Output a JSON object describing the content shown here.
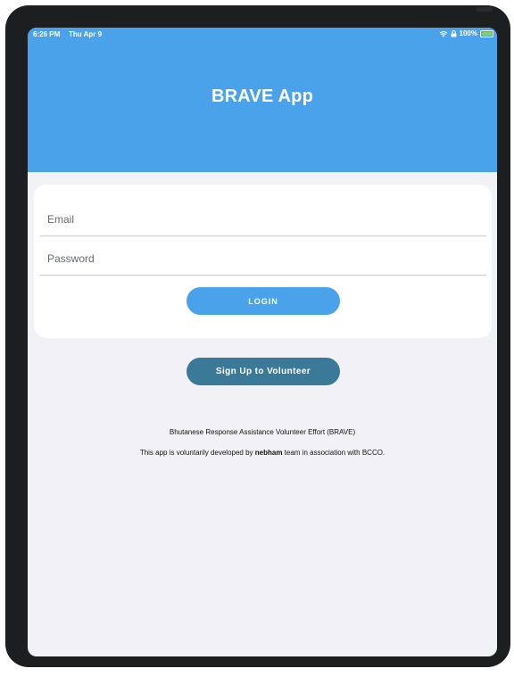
{
  "status_bar": {
    "time": "6:26 PM",
    "date": "Thu Apr 9",
    "battery": "100%",
    "icons": [
      "wifi-icon",
      "lock-rotation-icon",
      "battery-icon"
    ]
  },
  "header": {
    "title": "BRAVE App",
    "bg_color": "#4aa2ea"
  },
  "login_form": {
    "email_placeholder": "Email",
    "email_value": "",
    "password_placeholder": "Password",
    "password_value": "",
    "login_label": "LOGIN",
    "login_color": "#4aa2ea"
  },
  "signup": {
    "label": "Sign Up to Volunteer",
    "color": "#3a7a98"
  },
  "footer": {
    "line1": "Bhutanese Response Assistance Volunteer Effort (BRAVE)",
    "line2_prefix": "This app is voluntarily developed by ",
    "line2_team": "nebham",
    "line2_suffix": " team in association with BCCO."
  }
}
